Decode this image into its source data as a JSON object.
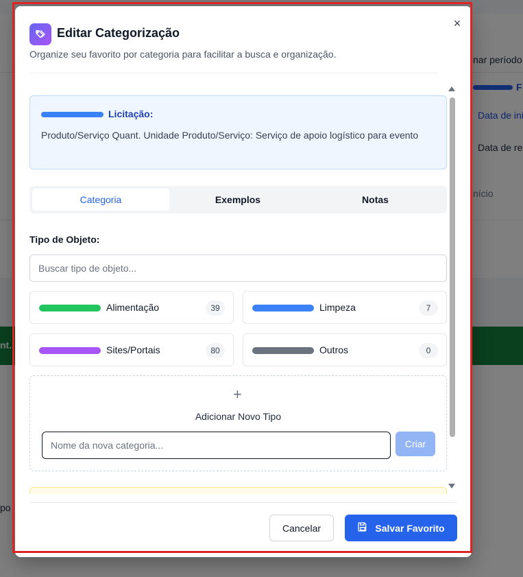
{
  "background": {
    "text_periodo": "nar período",
    "text_f": "F",
    "text_data_ini": "Data de ini",
    "text_data_re": "Data de re",
    "text_inicio": "nício",
    "text_nt": "nt.",
    "text_po": "po"
  },
  "modal": {
    "title": "Editar Categorização",
    "subtitle": "Organize seu favorito por categoria para facilitar a busca e organização.",
    "close_label": "×",
    "licitacao": {
      "label": "Licitação:",
      "text": "Produto/Serviço Quant. Unidade Produto/Serviço: Serviço de apoio logístico para evento"
    },
    "tabs": [
      {
        "label": "Categoria",
        "active": true
      },
      {
        "label": "Exemplos",
        "active": false
      },
      {
        "label": "Notas",
        "active": false
      }
    ],
    "tipo_objeto": {
      "label": "Tipo de Objeto:",
      "search_placeholder": "Buscar tipo de objeto..."
    },
    "categories": [
      {
        "name": "Alimentação",
        "count": "39",
        "color": "#22c55e"
      },
      {
        "name": "Limpeza",
        "count": "7",
        "color": "#3b82f6"
      },
      {
        "name": "Sites/Portais",
        "count": "80",
        "color": "#a855f7"
      },
      {
        "name": "Outros",
        "count": "0",
        "color": "#6b7280"
      }
    ],
    "add_new": {
      "plus": "+",
      "title": "Adicionar Novo Tipo",
      "input_placeholder": "Nome da nova categoria...",
      "create_label": "Criar"
    },
    "footer": {
      "cancel_label": "Cancelar",
      "save_label": "Salvar Favorito"
    }
  }
}
